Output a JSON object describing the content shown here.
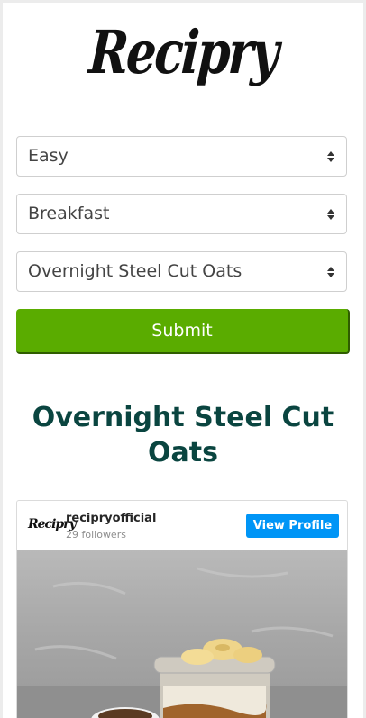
{
  "brand": {
    "logo_text": "Recipry"
  },
  "form": {
    "difficulty": {
      "selected": "Easy"
    },
    "meal_type": {
      "selected": "Breakfast"
    },
    "recipe": {
      "selected": "Overnight Steel Cut Oats"
    },
    "submit_label": "Submit"
  },
  "recipe": {
    "title": "Overnight Steel Cut Oats"
  },
  "instagram_embed": {
    "avatar_text": "Recipry",
    "username": "recipryofficial",
    "followers": "29 followers",
    "view_profile_label": "View Profile",
    "image_icon": "jar-of-oats-with-banana-photo"
  },
  "colors": {
    "submit": "#5aac00",
    "title": "#0a4540",
    "view_profile": "#0095f6"
  }
}
